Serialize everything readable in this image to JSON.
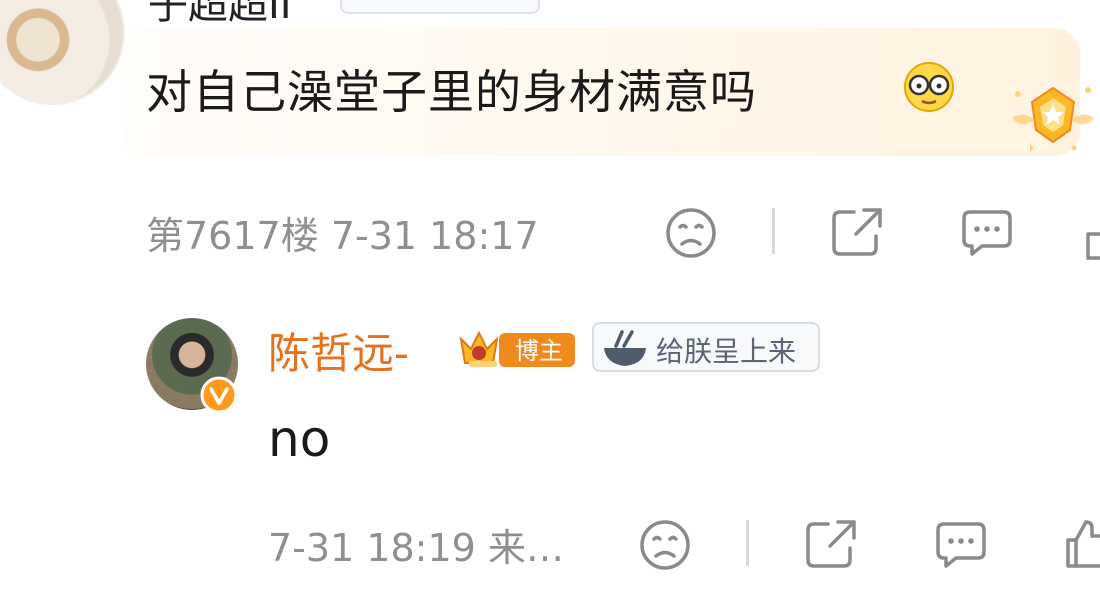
{
  "top": {
    "cut_text": "子超超II"
  },
  "comment": {
    "text": "对自己澡堂子里的身材满意吗",
    "floor": "第7617楼",
    "time": "7-31 18:17"
  },
  "reply": {
    "username": "陈哲远-",
    "blogger_label": "博主",
    "fan_badge_label": "给朕呈上来",
    "text": "no",
    "time": "7-31 18:19",
    "source_truncated": "来…"
  },
  "colors": {
    "username": "#e8701a",
    "meta_gray": "#8f8f8f",
    "icon_gray": "#8a8a8a",
    "blogger_orange": "#f08a1c"
  },
  "icons": {
    "dislike": "sad-face-icon",
    "share": "share-icon",
    "comment": "comment-bubble-icon",
    "like": "thumbs-up-icon"
  }
}
